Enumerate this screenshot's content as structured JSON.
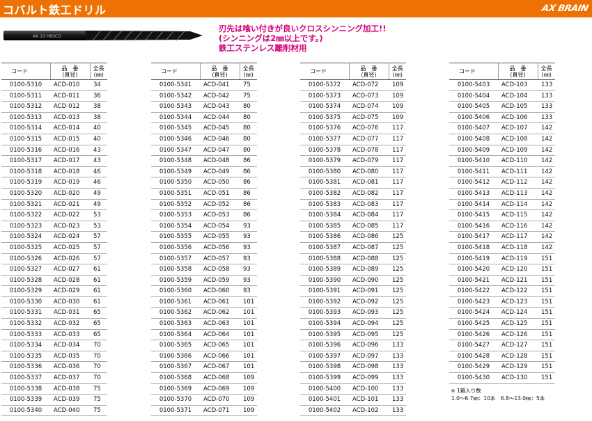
{
  "header": {
    "title": "コバルト鉄工ドリル",
    "brand": "AX BRAIN"
  },
  "product_image": {
    "marking": "AX 10 H6SCO"
  },
  "notes": [
    "刃先は喰い付きが良いクロスシンニング加工!!",
    "(シンニングは2㎜以上です。)",
    "鉄工ステンレス離削材用"
  ],
  "table_header": {
    "code": "コード",
    "part_no": "品　番",
    "diameter": "(直径)",
    "length": "全長",
    "unit": "(㎜)"
  },
  "tables": [
    {
      "rows": [
        [
          "0100-5310",
          "ACD-010",
          "34"
        ],
        [
          "0100-5311",
          "ACD-011",
          "36"
        ],
        [
          "0100-5312",
          "ACD-012",
          "38"
        ],
        [
          "0100-5313",
          "ACD-013",
          "38"
        ],
        [
          "0100-5314",
          "ACD-014",
          "40"
        ],
        [
          "0100-5315",
          "ACD-015",
          "40"
        ],
        [
          "0100-5316",
          "ACD-016",
          "43"
        ],
        [
          "0100-5317",
          "ACD-017",
          "43"
        ],
        [
          "0100-5318",
          "ACD-018",
          "46"
        ],
        [
          "0100-5319",
          "ACD-019",
          "46"
        ],
        [
          "0100-5320",
          "ACD-020",
          "49"
        ],
        [
          "0100-5321",
          "ACD-021",
          "49"
        ],
        [
          "0100-5322",
          "ACD-022",
          "53"
        ],
        [
          "0100-5323",
          "ACD-023",
          "53"
        ],
        [
          "0100-5324",
          "ACD-024",
          "57"
        ],
        [
          "0100-5325",
          "ACD-025",
          "57"
        ],
        [
          "0100-5326",
          "ACD-026",
          "57"
        ],
        [
          "0100-5327",
          "ACD-027",
          "61"
        ],
        [
          "0100-5328",
          "ACD-028",
          "61"
        ],
        [
          "0100-5329",
          "ACD-029",
          "61"
        ],
        [
          "0100-5330",
          "ACD-030",
          "61"
        ],
        [
          "0100-5331",
          "ACD-031",
          "65"
        ],
        [
          "0100-5332",
          "ACD-032",
          "65"
        ],
        [
          "0100-5333",
          "ACD-033",
          "65"
        ],
        [
          "0100-5334",
          "ACD-034",
          "70"
        ],
        [
          "0100-5335",
          "ACD-035",
          "70"
        ],
        [
          "0100-5336",
          "ACD-036",
          "70"
        ],
        [
          "0100-5337",
          "ACD-037",
          "70"
        ],
        [
          "0100-5338",
          "ACD-038",
          "75"
        ],
        [
          "0100-5339",
          "ACD-039",
          "75"
        ],
        [
          "0100-5340",
          "ACD-040",
          "75"
        ]
      ]
    },
    {
      "rows": [
        [
          "0100-5341",
          "ACD-041",
          "75"
        ],
        [
          "0100-5342",
          "ACD-042",
          "75"
        ],
        [
          "0100-5343",
          "ACD-043",
          "80"
        ],
        [
          "0100-5344",
          "ACD-044",
          "80"
        ],
        [
          "0100-5345",
          "ACD-045",
          "80"
        ],
        [
          "0100-5346",
          "ACD-046",
          "80"
        ],
        [
          "0100-5347",
          "ACD-047",
          "80"
        ],
        [
          "0100-5348",
          "ACD-048",
          "86"
        ],
        [
          "0100-5349",
          "ACD-049",
          "86"
        ],
        [
          "0100-5350",
          "ACD-050",
          "86"
        ],
        [
          "0100-5351",
          "ACD-051",
          "86"
        ],
        [
          "0100-5352",
          "ACD-052",
          "86"
        ],
        [
          "0100-5353",
          "ACD-053",
          "86"
        ],
        [
          "0100-5354",
          "ACD-054",
          "93"
        ],
        [
          "0100-5355",
          "ACD-055",
          "93"
        ],
        [
          "0100-5356",
          "ACD-056",
          "93"
        ],
        [
          "0100-5357",
          "ACD-057",
          "93"
        ],
        [
          "0100-5358",
          "ACD-058",
          "93"
        ],
        [
          "0100-5359",
          "ACD-059",
          "93"
        ],
        [
          "0100-5360",
          "ACD-060",
          "93"
        ],
        [
          "0100-5361",
          "ACD-061",
          "101"
        ],
        [
          "0100-5362",
          "ACD-062",
          "101"
        ],
        [
          "0100-5363",
          "ACD-063",
          "101"
        ],
        [
          "0100-5364",
          "ACD-064",
          "101"
        ],
        [
          "0100-5365",
          "ACD-065",
          "101"
        ],
        [
          "0100-5366",
          "ACD-066",
          "101"
        ],
        [
          "0100-5367",
          "ACD-067",
          "101"
        ],
        [
          "0100-5368",
          "ACD-068",
          "109"
        ],
        [
          "0100-5369",
          "ACD-069",
          "109"
        ],
        [
          "0100-5370",
          "ACD-070",
          "109"
        ],
        [
          "0100-5371",
          "ACD-071",
          "109"
        ]
      ]
    },
    {
      "rows": [
        [
          "0100-5372",
          "ACD-072",
          "109"
        ],
        [
          "0100-5373",
          "ACD-073",
          "109"
        ],
        [
          "0100-5374",
          "ACD-074",
          "109"
        ],
        [
          "0100-5375",
          "ACD-075",
          "109"
        ],
        [
          "0100-5376",
          "ACD-076",
          "117"
        ],
        [
          "0100-5377",
          "ACD-077",
          "117"
        ],
        [
          "0100-5378",
          "ACD-078",
          "117"
        ],
        [
          "0100-5379",
          "ACD-079",
          "117"
        ],
        [
          "0100-5380",
          "ACD-080",
          "117"
        ],
        [
          "0100-5381",
          "ACD-081",
          "117"
        ],
        [
          "0100-5382",
          "ACD-082",
          "117"
        ],
        [
          "0100-5383",
          "ACD-083",
          "117"
        ],
        [
          "0100-5384",
          "ACD-084",
          "117"
        ],
        [
          "0100-5385",
          "ACD-085",
          "117"
        ],
        [
          "0100-5386",
          "ACD-086",
          "125"
        ],
        [
          "0100-5387",
          "ACD-087",
          "125"
        ],
        [
          "0100-5388",
          "ACD-088",
          "125"
        ],
        [
          "0100-5389",
          "ACD-089",
          "125"
        ],
        [
          "0100-5390",
          "ACD-090",
          "125"
        ],
        [
          "0100-5391",
          "ACD-091",
          "125"
        ],
        [
          "0100-5392",
          "ACD-092",
          "125"
        ],
        [
          "0100-5393",
          "ACD-093",
          "125"
        ],
        [
          "0100-5394",
          "ACD-094",
          "125"
        ],
        [
          "0100-5395",
          "ACD-095",
          "125"
        ],
        [
          "0100-5396",
          "ACD-096",
          "133"
        ],
        [
          "0100-5397",
          "ACD-097",
          "133"
        ],
        [
          "0100-5398",
          "ACD-098",
          "133"
        ],
        [
          "0100-5399",
          "ACD-099",
          "133"
        ],
        [
          "0100-5400",
          "ACD-100",
          "133"
        ],
        [
          "0100-5401",
          "ACD-101",
          "133"
        ],
        [
          "0100-5402",
          "ACD-102",
          "133"
        ]
      ]
    },
    {
      "rows": [
        [
          "0100-5403",
          "ACD-103",
          "133"
        ],
        [
          "0100-5404",
          "ACD-104",
          "133"
        ],
        [
          "0100-5405",
          "ACD-105",
          "133"
        ],
        [
          "0100-5406",
          "ACD-106",
          "133"
        ],
        [
          "0100-5407",
          "ACD-107",
          "142"
        ],
        [
          "0100-5408",
          "ACD-108",
          "142"
        ],
        [
          "0100-5409",
          "ACD-109",
          "142"
        ],
        [
          "0100-5410",
          "ACD-110",
          "142"
        ],
        [
          "0100-5411",
          "ACD-111",
          "142"
        ],
        [
          "0100-5412",
          "ACD-112",
          "142"
        ],
        [
          "0100-5413",
          "ACD-113",
          "142"
        ],
        [
          "0100-5414",
          "ACD-114",
          "142"
        ],
        [
          "0100-5415",
          "ACD-115",
          "142"
        ],
        [
          "0100-5416",
          "ACD-116",
          "142"
        ],
        [
          "0100-5417",
          "ACD-117",
          "142"
        ],
        [
          "0100-5418",
          "ACD-118",
          "142"
        ],
        [
          "0100-5419",
          "ACD-119",
          "151"
        ],
        [
          "0100-5420",
          "ACD-120",
          "151"
        ],
        [
          "0100-5421",
          "ACD-121",
          "151"
        ],
        [
          "0100-5422",
          "ACD-122",
          "151"
        ],
        [
          "0100-5423",
          "ACD-123",
          "151"
        ],
        [
          "0100-5424",
          "ACD-124",
          "151"
        ],
        [
          "0100-5425",
          "ACD-125",
          "151"
        ],
        [
          "0100-5426",
          "ACD-126",
          "151"
        ],
        [
          "0100-5427",
          "ACD-127",
          "151"
        ],
        [
          "0100-5428",
          "ACD-128",
          "151"
        ],
        [
          "0100-5429",
          "ACD-129",
          "151"
        ],
        [
          "0100-5430",
          "ACD-130",
          "151"
        ]
      ]
    }
  ],
  "footnote": {
    "line1": "1箱入り数",
    "line2": "1.0〜6.7㎜：10本　6.8〜13.0㎜：5本"
  },
  "colors": {
    "header_bg": "#ee7203",
    "note_text": "#d4007a"
  }
}
